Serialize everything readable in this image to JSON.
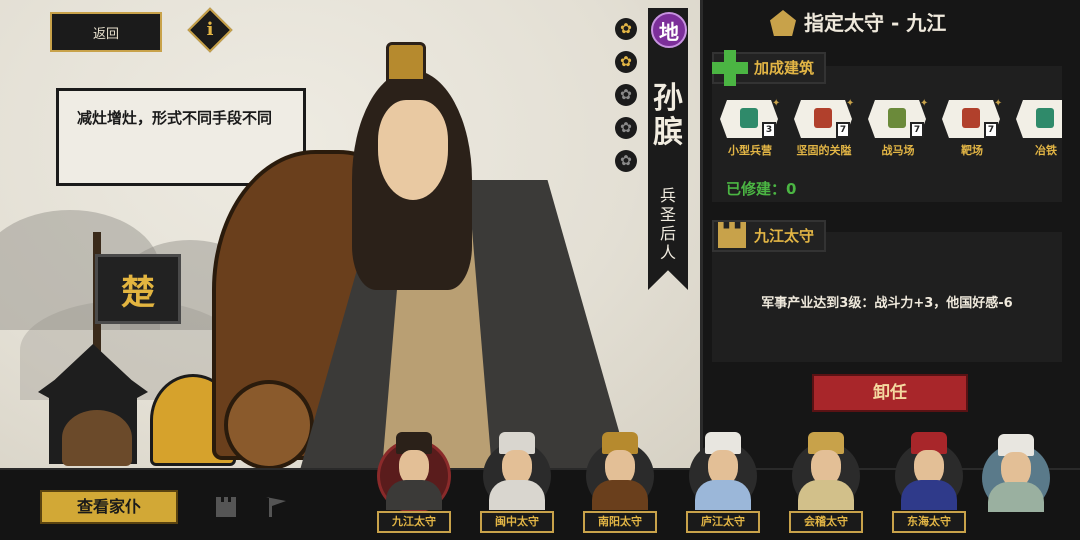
{
  "top_left": {
    "back_label": "返回",
    "info_symbol": "i"
  },
  "speech": {
    "text": "减灶增灶，形式不同手段不同"
  },
  "flag": {
    "char": "楚"
  },
  "character": {
    "tier": "地",
    "name": "孙膑",
    "title": "兵圣后人",
    "stars": [
      {
        "icon": "gold-flower-icon"
      },
      {
        "icon": "gold-flower-icon"
      },
      {
        "icon": "gray-flower-icon"
      },
      {
        "icon": "gray-flower-icon"
      },
      {
        "icon": "gray-flower-icon"
      }
    ]
  },
  "panel": {
    "title": "指定太守 - 九江",
    "buildings_section": "加成建筑",
    "buildings": [
      {
        "label": "小型兵营",
        "level": "3",
        "icon_color": "#2f8a6a"
      },
      {
        "label": "坚固的关隘",
        "level": "7",
        "icon_color": "#b1402c"
      },
      {
        "label": "战马场",
        "level": "7",
        "icon_color": "#6b8a3a"
      },
      {
        "label": "靶场",
        "level": "7",
        "icon_color": "#b1402c"
      },
      {
        "label": "冶铁",
        "level": "",
        "icon_color": "#2f8a6a"
      }
    ],
    "built_text": "已修建：0",
    "governor_section": "九江太守",
    "effect_text": "军事产业达到3级：战斗力+3，他国好感-6",
    "dismiss_label": "卸任"
  },
  "bottom": {
    "family_label": "查看家仆",
    "portraits": [
      {
        "label": "九江太守",
        "hair": "#2b2119",
        "body": "#3b3a38",
        "active": true
      },
      {
        "label": "闽中太守",
        "hair": "#d9d6cf",
        "body": "#d9d6cf",
        "active": false
      },
      {
        "label": "南阳太守",
        "hair": "#b68a2e",
        "body": "#6a3f1c",
        "active": false
      },
      {
        "label": "庐江太守",
        "hair": "#e8e6e0",
        "body": "#9bb7d9",
        "active": false
      },
      {
        "label": "会稽太守",
        "hair": "#c8a24a",
        "body": "#d2c08a",
        "active": false
      },
      {
        "label": "东海太守",
        "hair": "#a8262a",
        "body": "#2f3a8a",
        "active": false
      }
    ]
  }
}
